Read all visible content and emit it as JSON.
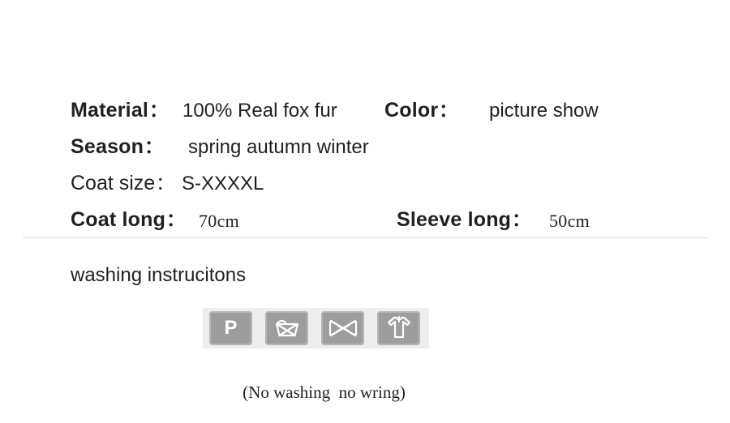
{
  "specs": {
    "rows": [
      {
        "left": {
          "label": "Material",
          "colon": "：",
          "value": "100%  Real fox fur"
        },
        "right": {
          "label": "Color",
          "colon": "：",
          "value": "picture show"
        }
      },
      {
        "left": {
          "label": "Season",
          "colon": "：",
          "value": "spring autumn winter"
        },
        "right": null
      },
      {
        "left": {
          "label": "Coat size",
          "colon": "：",
          "value": "S-XXXXL"
        },
        "right": null
      },
      {
        "left": {
          "label": "Coat long",
          "colon": "：",
          "value": "70cm"
        },
        "right": {
          "label": "Sleeve long",
          "colon": "：",
          "value": "50cm"
        }
      }
    ]
  },
  "washing": {
    "title": "washing instrucitons",
    "caption": "(No washing  no wring)",
    "icons": [
      {
        "name": "dry-clean-professional-icon",
        "glyph": "P",
        "label": "P"
      },
      {
        "name": "do-not-wash-icon",
        "glyph": "",
        "label": "do not wash"
      },
      {
        "name": "do-not-wring-icon",
        "glyph": "",
        "label": "do not wring"
      },
      {
        "name": "drip-dry-shirt-icon",
        "glyph": "",
        "label": "drip dry"
      }
    ]
  },
  "colors": {
    "text": "#231f20",
    "divider": "#d7d7d7",
    "panel_bg": "#ededed",
    "icon_bg": "#9d9d9d",
    "icon_border": "#b6b6b6",
    "icon_fg": "#ffffff",
    "page_bg": "#ffffff"
  }
}
